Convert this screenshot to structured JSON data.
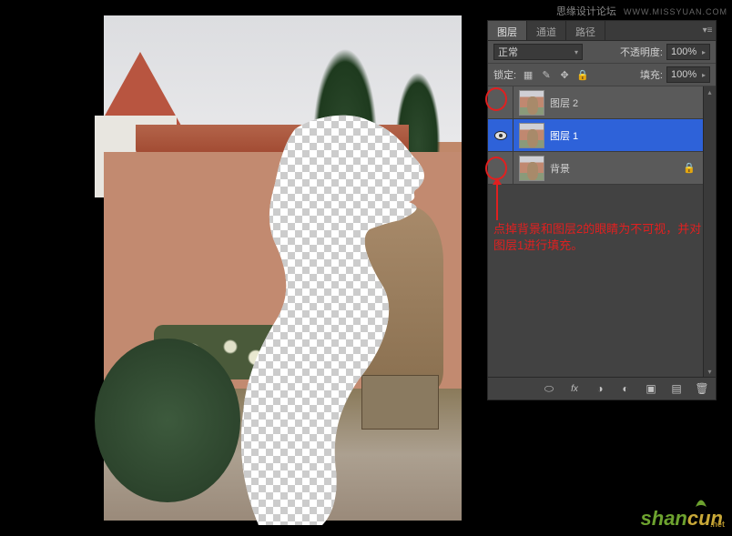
{
  "watermarks": {
    "top_cn": "思缘设计论坛",
    "top_en": "WWW.MISSYUAN.COM",
    "bottom_shan": "shan",
    "bottom_cun": "cun",
    "bottom_net": ".net"
  },
  "panel": {
    "tabs": {
      "layers": "图层",
      "channels": "通道",
      "paths": "路径"
    },
    "blend_mode": "正常",
    "opacity_label": "不透明度:",
    "opacity_value": "100%",
    "lock_label": "锁定:",
    "fill_label": "填充:",
    "fill_value": "100%",
    "layers": [
      {
        "name": "图层 2",
        "visible": false,
        "selected": false,
        "locked": false
      },
      {
        "name": "图层 1",
        "visible": true,
        "selected": true,
        "locked": false
      },
      {
        "name": "背景",
        "visible": false,
        "selected": false,
        "locked": true
      }
    ],
    "footer_icons": {
      "link": "link-icon",
      "fx": "fx",
      "mask": "mask-icon",
      "adjust": "adjustment-icon",
      "group": "group-icon",
      "new": "new-layer-icon",
      "trash": "trash-icon"
    }
  },
  "annotation": {
    "text": "点掉背景和图层2的眼睛为不可视，并对图层1进行填充。"
  }
}
